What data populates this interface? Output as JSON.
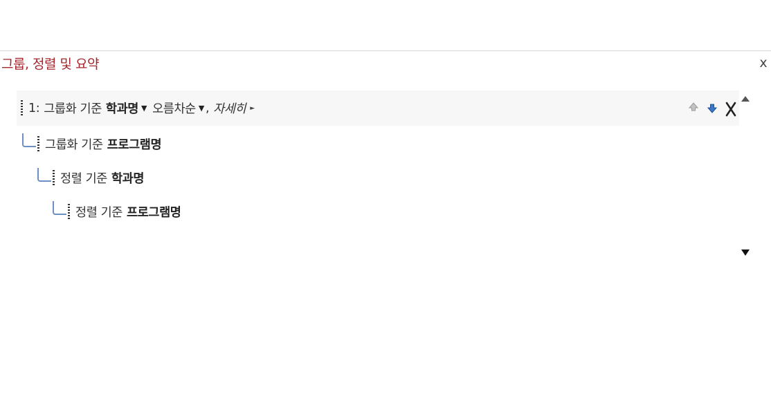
{
  "pane": {
    "title": "그룹, 정렬 및 요약",
    "close_label": "x"
  },
  "levels": [
    {
      "index": "1:",
      "prefix": "그룹화 기준",
      "field": "학과명",
      "order": "오름차순",
      "separator": ",",
      "more_label": "자세히",
      "expanded": true
    },
    {
      "prefix": "그룹화 기준",
      "field": "프로그램명"
    },
    {
      "prefix": "정렬 기준",
      "field": "학과명"
    },
    {
      "prefix": "정렬 기준",
      "field": "프로그램명"
    }
  ],
  "icons": {
    "move_up": "arrow-up-icon",
    "move_down": "arrow-down-icon",
    "delete": "delete-icon",
    "scroll_up": "scroll-up-icon",
    "scroll_down": "scroll-down-icon"
  },
  "colors": {
    "title": "#a4262c",
    "connector": "#6b8ec4",
    "row_highlight": "#f7f7f7"
  }
}
